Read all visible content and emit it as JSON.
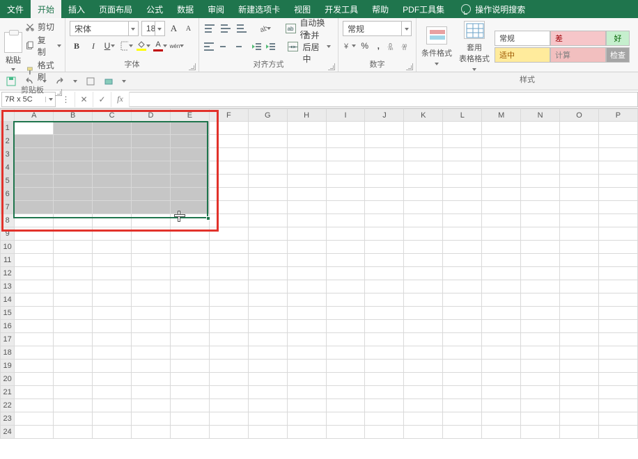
{
  "menubar": {
    "tabs": [
      "文件",
      "开始",
      "插入",
      "页面布局",
      "公式",
      "数据",
      "审阅",
      "新建选项卡",
      "视图",
      "开发工具",
      "帮助",
      "PDF工具集"
    ],
    "active_index": 1,
    "search_placeholder": "操作说明搜索"
  },
  "ribbon": {
    "clipboard": {
      "paste": "粘贴",
      "cut": "剪切",
      "copy": "复制",
      "painter": "格式刷",
      "group_label": "剪贴板"
    },
    "font": {
      "name": "宋体",
      "size": "18",
      "grow_label": "A",
      "shrink_label": "A",
      "bold": "B",
      "italic": "I",
      "underline": "U",
      "ruby": "wén",
      "font_color": "#c00000",
      "fill_color": "#ffff00",
      "group_label": "字体"
    },
    "alignment": {
      "wrap": "自动换行",
      "merge": "合并后居中",
      "group_label": "对齐方式"
    },
    "number": {
      "format": "常规",
      "percent": "%",
      "comma": ",",
      "inc_dec": "增加小数位",
      "dec_dec": "减少小数位",
      "group_label": "数字"
    },
    "styles": {
      "cond": "条件格式",
      "table": "套用\n表格格式",
      "cells": [
        {
          "label": "常规",
          "bg": "#ffffff",
          "fg": "#444"
        },
        {
          "label": "差",
          "bg": "#f6c6c9",
          "fg": "#9c0006"
        },
        {
          "label": "好",
          "bg": "#c6efce",
          "fg": "#006100"
        },
        {
          "label": "适中",
          "bg": "#ffeb9c",
          "fg": "#9c5700"
        },
        {
          "label": "计算",
          "bg": "#f2bfbf",
          "fg": "#7f7f7f"
        },
        {
          "label": "检查",
          "bg": "#a5a5a5",
          "fg": "#ffffff"
        }
      ],
      "group_label": "样式"
    }
  },
  "formula_bar": {
    "name_box": "7R x 5C",
    "fx_label": "fx",
    "formula": ""
  },
  "grid": {
    "columns": [
      "A",
      "B",
      "C",
      "D",
      "E",
      "F",
      "G",
      "H",
      "I",
      "J",
      "K",
      "L",
      "M",
      "N",
      "O",
      "P"
    ],
    "row_count": 24,
    "selection": {
      "r1": 1,
      "c1": 1,
      "r2": 7,
      "c2": 5
    },
    "active_cell": {
      "r": 1,
      "c": 1
    }
  }
}
